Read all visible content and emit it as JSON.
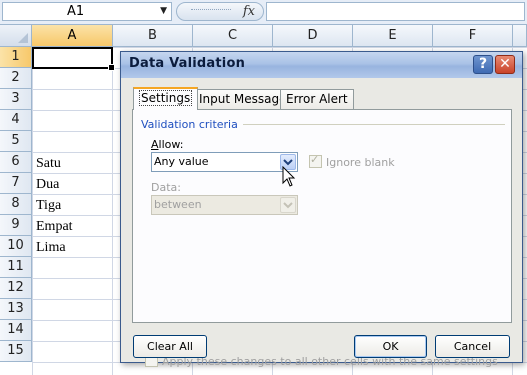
{
  "excel": {
    "name_box": "A1",
    "fx_label": "fx",
    "columns": [
      "A",
      "B",
      "C",
      "D",
      "E",
      "F"
    ],
    "rows": [
      "1",
      "2",
      "3",
      "4",
      "5",
      "6",
      "7",
      "8",
      "9",
      "10",
      "11",
      "12",
      "13",
      "14",
      "15"
    ],
    "cells": {
      "A6": "Satu",
      "A7": "Dua",
      "A8": "Tiga",
      "A9": "Empat",
      "A10": "Lima"
    }
  },
  "dialog": {
    "title": "Data Validation",
    "help": "?",
    "close": "✕",
    "tabs": {
      "settings": "Settings",
      "input_message": "Input Message",
      "error_alert": "Error Alert"
    },
    "criteria_label": "Validation criteria",
    "allow_label_prefix": "",
    "allow_label_underlined": "A",
    "allow_label_rest": "llow:",
    "allow_value": "Any value",
    "ignore_blank": "Ignore blank",
    "data_label": "Data:",
    "data_value": "between",
    "apply_all": "Apply these changes to all other cells with the same settings",
    "clear_all": "Clear All",
    "ok": "OK",
    "cancel": "Cancel"
  },
  "colors": {
    "selected_header": "#f7c86a",
    "title_bar": "#a9c2e6",
    "criteria_text": "#1f4fbf"
  }
}
